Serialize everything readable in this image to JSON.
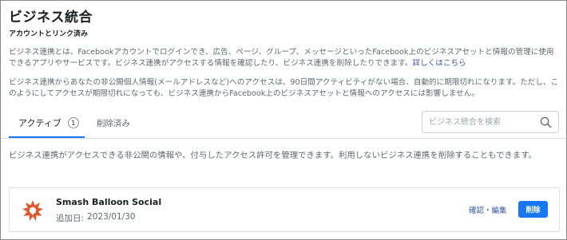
{
  "page": {
    "title": "ビジネス統合",
    "subtitle": "アカウントとリンク済み",
    "intro_text": "ビジネス連携とは、Facebookアカウントでログインでき、広告、ページ、グループ、メッセージといったFacebook上のビジネスアセットと情報の管理に使用できるアプリやサービスです。ビジネス連携がアクセスする情報を確認したり、ビジネス連携を削除したりできます。",
    "learn_more_link": "詳しくはこちら",
    "expiry_text": "ビジネス連携からあなたの非公開個人情報(メールアドレスなど)へのアクセスは、90日間アクティビティがない場合、自動的に期限切れになります。ただし、このようにしてアクセスが期限切れになっても、ビジネス連携からFacebook上のビジネスアセットと情報へのアクセスには影響しません。",
    "manage_text": "ビジネス連携がアクセスできる非公開の情報や、付与したアクセス許可を管理できます。利用しないビジネス連携を削除することもできます。"
  },
  "tabs": {
    "active_label": "アクティブ",
    "active_count": "1",
    "deleted_label": "削除済み"
  },
  "search": {
    "placeholder": "ビジネス統合を検索",
    "value": ""
  },
  "integration": {
    "name": "Smash Balloon Social",
    "added_label": "追加日:",
    "added_date": "2023/01/30",
    "edit_label": "確認・編集",
    "delete_label": "削除"
  },
  "colors": {
    "accent": "#1877f2",
    "link": "#385898",
    "app_icon": "#e4572e"
  },
  "icons": {
    "search": "search-icon",
    "app": "smash-balloon-icon"
  }
}
